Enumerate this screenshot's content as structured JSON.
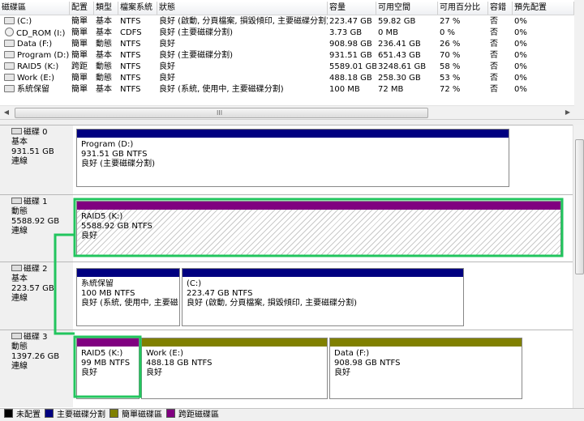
{
  "volume_list": {
    "columns": [
      "磁碟區",
      "配置",
      "類型",
      "檔案系統",
      "狀態",
      "容量",
      "可用空間",
      "可用百分比",
      "容錯",
      "預先配置"
    ],
    "rows": [
      {
        "icon": "volume-icon",
        "name": "(C:)",
        "layout": "簡單",
        "type": "基本",
        "fs": "NTFS",
        "status": "良好 (啟動, 分頁檔案, 損毀傾印, 主要磁碟分割)",
        "capacity": "223.47 GB",
        "free": "59.82 GB",
        "pct": "27 %",
        "fault": "否",
        "overhead": "0%"
      },
      {
        "icon": "cd-icon",
        "name": "CD_ROM (I:)",
        "layout": "簡單",
        "type": "基本",
        "fs": "CDFS",
        "status": "良好 (主要磁碟分割)",
        "capacity": "3.73 GB",
        "free": "0 MB",
        "pct": "0 %",
        "fault": "否",
        "overhead": "0%"
      },
      {
        "icon": "volume-icon",
        "name": "Data (F:)",
        "layout": "簡單",
        "type": "動態",
        "fs": "NTFS",
        "status": "良好",
        "capacity": "908.98 GB",
        "free": "236.41 GB",
        "pct": "26 %",
        "fault": "否",
        "overhead": "0%"
      },
      {
        "icon": "volume-icon",
        "name": "Program (D:)",
        "layout": "簡單",
        "type": "基本",
        "fs": "NTFS",
        "status": "良好 (主要磁碟分割)",
        "capacity": "931.51 GB",
        "free": "651.43 GB",
        "pct": "70 %",
        "fault": "否",
        "overhead": "0%"
      },
      {
        "icon": "volume-icon",
        "name": "RAID5 (K:)",
        "layout": "跨距",
        "type": "動態",
        "fs": "NTFS",
        "status": "良好",
        "capacity": "5589.01 GB",
        "free": "3248.61 GB",
        "pct": "58 %",
        "fault": "否",
        "overhead": "0%"
      },
      {
        "icon": "volume-icon",
        "name": "Work (E:)",
        "layout": "簡單",
        "type": "動態",
        "fs": "NTFS",
        "status": "良好",
        "capacity": "488.18 GB",
        "free": "258.30 GB",
        "pct": "53 %",
        "fault": "否",
        "overhead": "0%"
      },
      {
        "icon": "volume-icon",
        "name": "系統保留",
        "layout": "簡單",
        "type": "基本",
        "fs": "NTFS",
        "status": "良好 (系統, 使用中, 主要磁碟分割)",
        "capacity": "100 MB",
        "free": "72 MB",
        "pct": "72 %",
        "fault": "否",
        "overhead": "0%"
      }
    ],
    "scroll_grip": "III"
  },
  "disks": [
    {
      "name": "磁碟 0",
      "type": "基本",
      "size": "931.51 GB",
      "state": "連線",
      "partitions": [
        {
          "title": "Program  (D:)",
          "size": "931.51 GB NTFS",
          "status": "良好 (主要磁碟分割)",
          "color": "#000080"
        }
      ]
    },
    {
      "name": "磁碟 1",
      "type": "動態",
      "size": "5588.92 GB",
      "state": "連線",
      "partitions": [
        {
          "title": "RAID5  (K:)",
          "size": "5588.92 GB NTFS",
          "status": "良好",
          "color": "#800080"
        }
      ]
    },
    {
      "name": "磁碟 2",
      "type": "基本",
      "size": "223.57 GB",
      "state": "連線",
      "partitions": [
        {
          "title": "系統保留",
          "size": "100 MB NTFS",
          "status": "良好 (系統, 使用中, 主要磁碟分",
          "color": "#000080"
        },
        {
          "title": "(C:)",
          "size": "223.47 GB NTFS",
          "status": "良好 (啟動, 分頁檔案, 損毀傾印, 主要磁碟分割)",
          "color": "#000080"
        }
      ]
    },
    {
      "name": "磁碟 3",
      "type": "動態",
      "size": "1397.26 GB",
      "state": "連線",
      "partitions": [
        {
          "title": "RAID5  (K:)",
          "size": "99 MB NTFS",
          "status": "良好",
          "color": "#800080"
        },
        {
          "title": "Work  (E:)",
          "size": "488.18 GB NTFS",
          "status": "良好",
          "color": "#808000"
        },
        {
          "title": "Data  (F:)",
          "size": "908.98 GB NTFS",
          "status": "良好",
          "color": "#808000"
        }
      ]
    }
  ],
  "legend": [
    {
      "label": "未配置",
      "color": "#000000"
    },
    {
      "label": "主要磁碟分割",
      "color": "#000080"
    },
    {
      "label": "簡單磁碟區",
      "color": "#808000"
    },
    {
      "label": "跨距磁碟區",
      "color": "#800080"
    }
  ],
  "highlight_color": "#22c55e"
}
